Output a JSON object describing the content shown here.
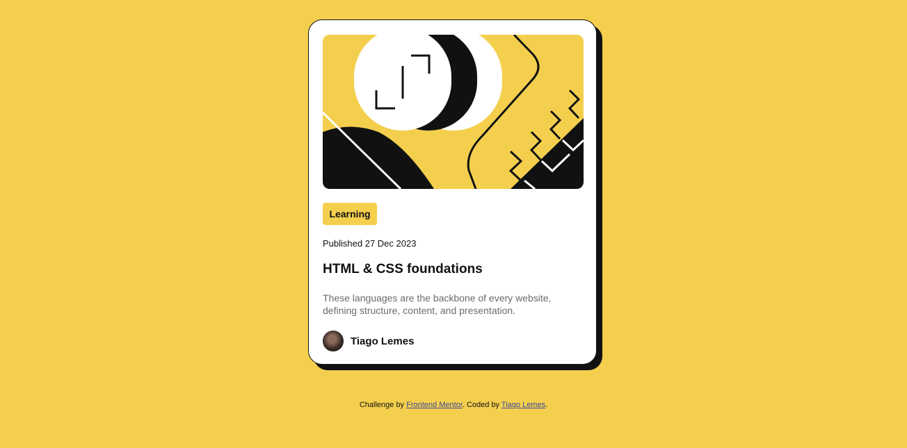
{
  "card": {
    "tag_label": "Learning",
    "published": "Published 27 Dec 2023",
    "title": "HTML & CSS foundations",
    "description": "These languages are the backbone of every website, defining structure, content, and presentation.",
    "author_name": "Tiago Lemes"
  },
  "footer": {
    "prefix": "Challenge by",
    "link1": "Frontend Mentor",
    "middle": ". Coded by",
    "link2": "Tiago Lemes",
    "suffix": "."
  },
  "colors": {
    "background": "#F4CF4E",
    "ink": "#111111",
    "muted_text": "#6b6b6b",
    "link": "#3a4a9a"
  }
}
